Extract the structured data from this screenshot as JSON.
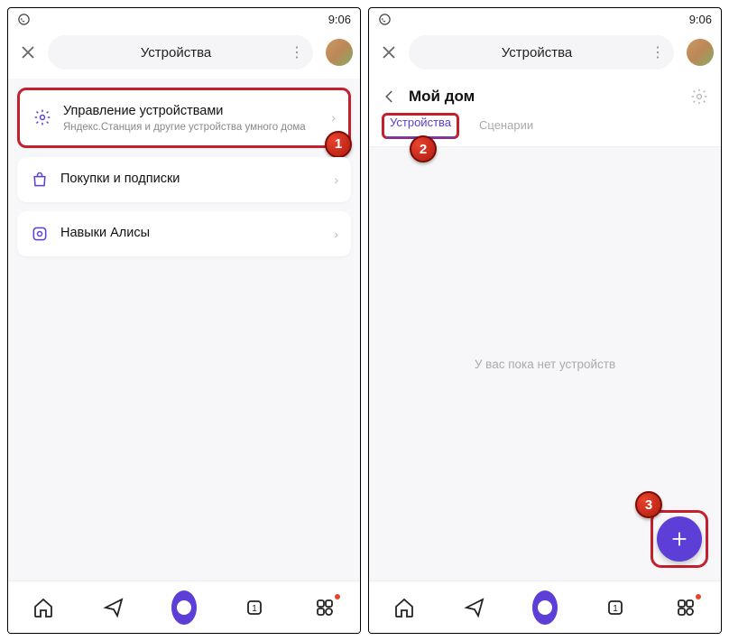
{
  "status": {
    "time": "9:06"
  },
  "screen1": {
    "title": "Устройства",
    "cards": {
      "manage": {
        "title": "Управление устройствами",
        "sub": "Яндекс.Станция и другие устройства умного дома"
      },
      "purchases": {
        "title": "Покупки и подписки"
      },
      "skills": {
        "title": "Навыки Алисы"
      }
    },
    "badge": "1"
  },
  "screen2": {
    "title": "Устройства",
    "home_title": "Мой дом",
    "tabs": {
      "devices": "Устройства",
      "scenarios": "Сценарии"
    },
    "empty": "У вас пока нет устройств",
    "badge_tab": "2",
    "badge_fab": "3"
  }
}
